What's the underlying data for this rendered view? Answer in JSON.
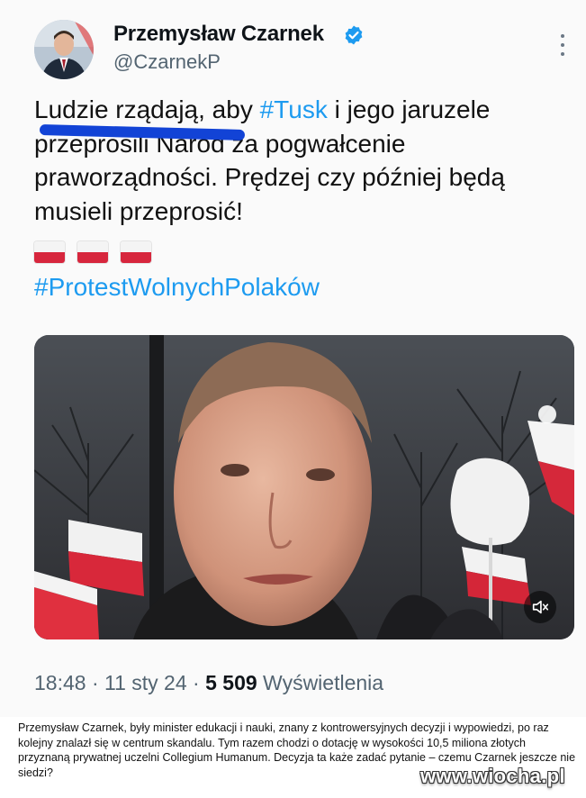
{
  "tweet": {
    "author": {
      "display_name": "Przemysław Czarnek",
      "handle": "@CzarnekP",
      "verified": true
    },
    "text": {
      "line1_start": "Ludzie rządają, aby ",
      "hashtag_tusk": "#Tusk",
      "line1_end": " i  jego jaruzele",
      "line2": "przeprosili Naród za pogwałcenie",
      "line3": "praworządności. Prędzej czy później będą",
      "line4": "musieli przeprosić!"
    },
    "flags": [
      "flag-poland-icon",
      "flag-poland-icon",
      "flag-poland-icon"
    ],
    "hashtag_protest": "#ProtestWolnychPolaków",
    "media": {
      "type": "video",
      "muted": true
    },
    "meta": {
      "time": "18:48",
      "sep1": " · ",
      "date": "11 sty 24",
      "sep2": " · ",
      "views": "5 509",
      "views_label": " Wyświetlenia"
    }
  },
  "caption": "Przemysław Czarnek, były minister edukacji i nauki, znany z kontrowersyjnych decyzji i wypowiedzi, po raz kolejny znalazł się w centrum skandalu. Tym razem chodzi o dotację w wysokości 10,5 miliona złotych przyznaną prywatnej uczelni Collegium Humanum. Decyzja ta każe zadać pytanie – czemu Czarnek jeszcze nie siedzi?",
  "watermark": "www.wiocha.pl",
  "colors": {
    "link": "#1d9bf0",
    "underline": "#1243d6",
    "verified": "#1d9bf0"
  }
}
